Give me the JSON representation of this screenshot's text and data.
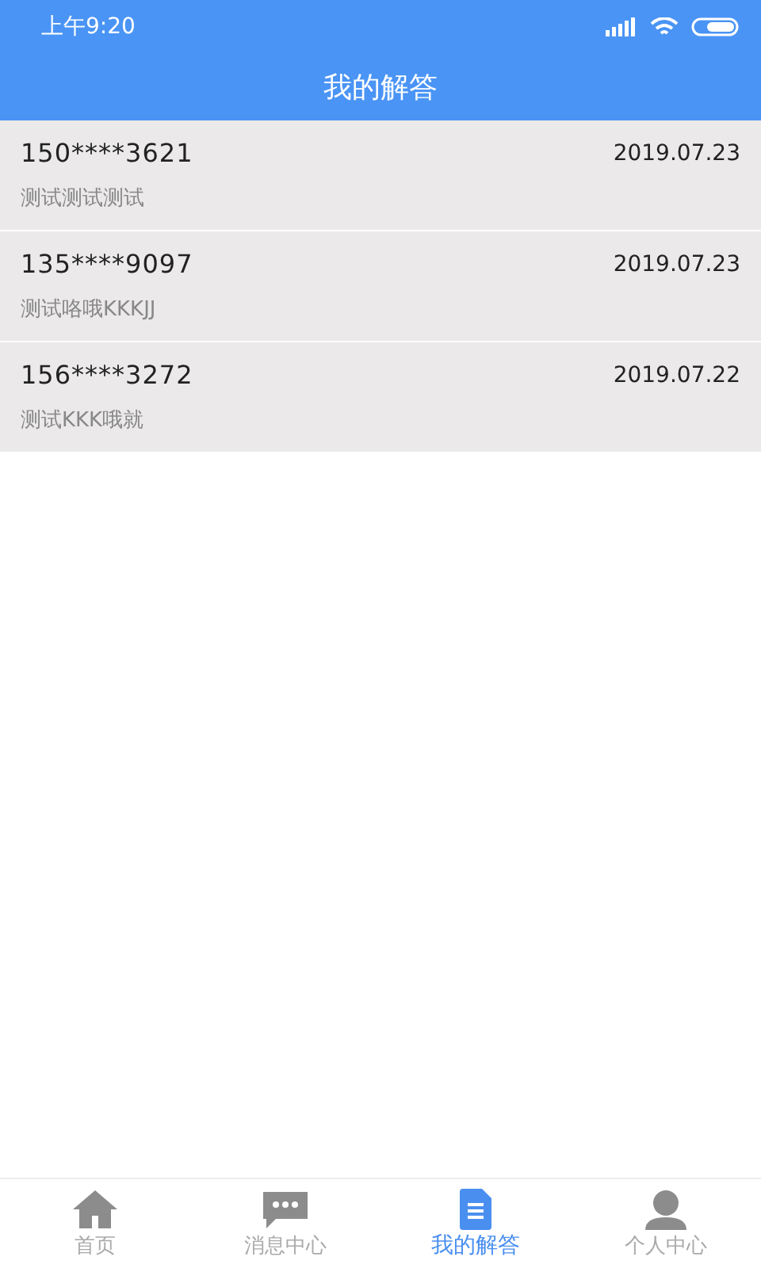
{
  "status_bar": {
    "time": "上午9:20"
  },
  "header": {
    "title": "我的解答"
  },
  "answers": [
    {
      "user": "150****3621",
      "date": "2019.07.23",
      "content": "测试测试测试"
    },
    {
      "user": "135****9097",
      "date": "2019.07.23",
      "content": "测试咯哦KKKJJ"
    },
    {
      "user": "156****3272",
      "date": "2019.07.22",
      "content": "测试KKK哦就"
    }
  ],
  "tabs": [
    {
      "kind": "home",
      "label": "首页",
      "selected": false
    },
    {
      "kind": "messages",
      "label": "消息中心",
      "selected": false
    },
    {
      "kind": "answers",
      "label": "我的解答",
      "selected": true
    },
    {
      "kind": "profile",
      "label": "个人中心",
      "selected": false
    }
  ]
}
